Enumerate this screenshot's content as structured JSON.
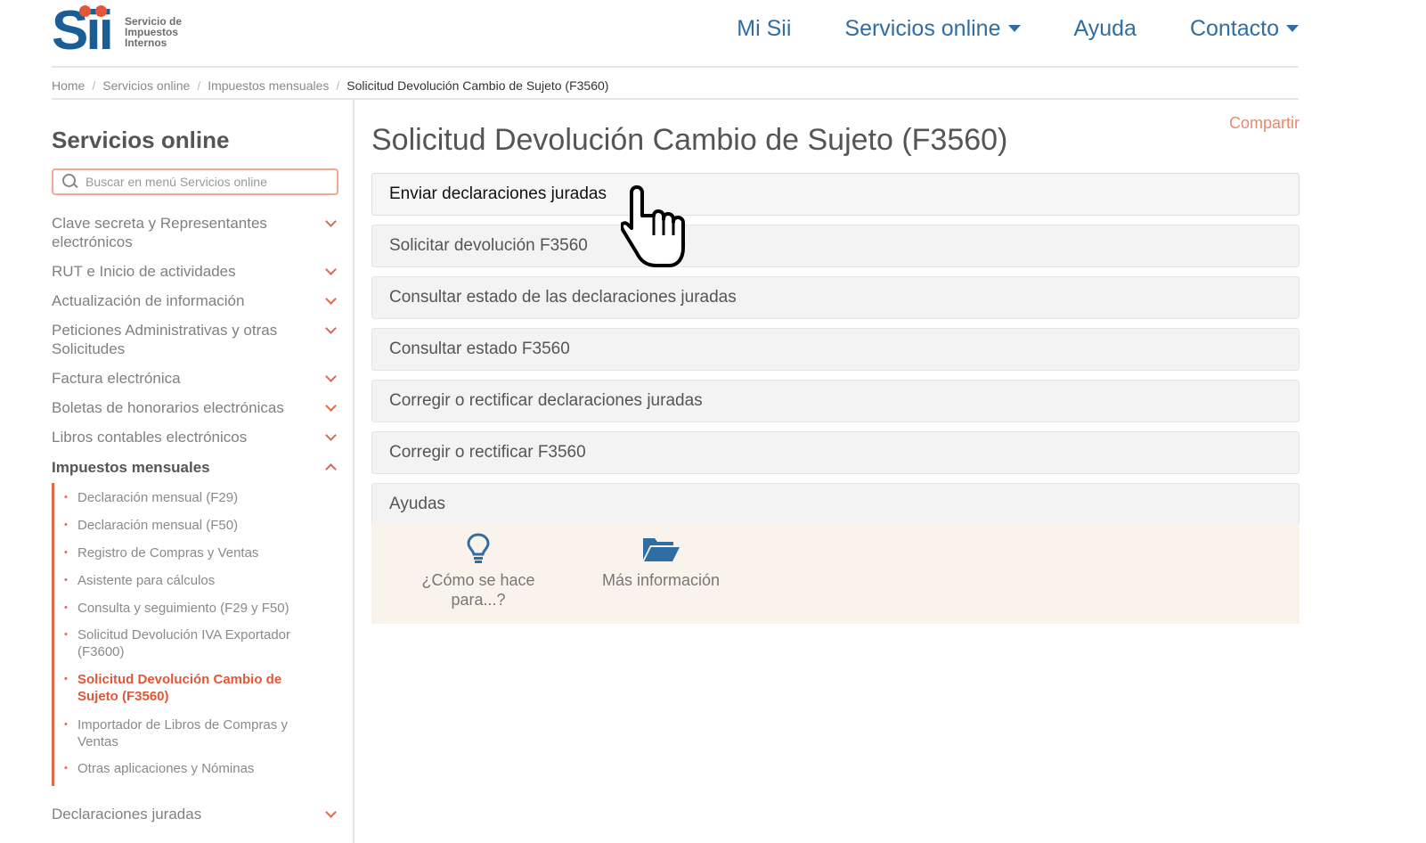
{
  "header": {
    "logo": {
      "mark": "Sii",
      "line1": "Servicio de",
      "line2": "Impuestos",
      "line3": "Internos"
    },
    "nav": [
      {
        "label": "Mi Sii",
        "has_caret": false
      },
      {
        "label": "Servicios online",
        "has_caret": true
      },
      {
        "label": "Ayuda",
        "has_caret": false
      },
      {
        "label": "Contacto",
        "has_caret": true
      }
    ]
  },
  "breadcrumb": {
    "items": [
      "Home",
      "Servicios online",
      "Impuestos mensuales"
    ],
    "current": "Solicitud Devolución Cambio de Sujeto (F3560)",
    "separator": "/"
  },
  "sidebar": {
    "title": "Servicios online",
    "search_placeholder": "Buscar en menú Servicios online",
    "items": [
      {
        "label": "Clave secreta y Representantes electrónicos",
        "expanded": false
      },
      {
        "label": "RUT e Inicio de actividades",
        "expanded": false
      },
      {
        "label": "Actualización de información",
        "expanded": false
      },
      {
        "label": "Peticiones Administrativas y otras Solicitudes",
        "expanded": false
      },
      {
        "label": "Factura electrónica",
        "expanded": false
      },
      {
        "label": "Boletas de honorarios electrónicas",
        "expanded": false
      },
      {
        "label": "Libros contables electrónicos",
        "expanded": false
      },
      {
        "label": "Impuestos mensuales",
        "expanded": true
      },
      {
        "label": "Declaraciones juradas",
        "expanded": false
      }
    ],
    "subitems": [
      {
        "label": "Declaración mensual (F29)",
        "active": false
      },
      {
        "label": "Declaración mensual (F50)",
        "active": false
      },
      {
        "label": "Registro de Compras y Ventas",
        "active": false
      },
      {
        "label": "Asistente para cálculos",
        "active": false
      },
      {
        "label": "Consulta y seguimiento (F29 y F50)",
        "active": false
      },
      {
        "label": "Solicitud Devolución IVA Exportador (F3600)",
        "active": false
      },
      {
        "label": "Solicitud Devolución Cambio de Sujeto (F3560)",
        "active": true
      },
      {
        "label": "Importador de Libros de Compras y Ventas",
        "active": false
      },
      {
        "label": "Otras aplicaciones y Nóminas",
        "active": false
      }
    ]
  },
  "main": {
    "share_label": "Compartir",
    "title": "Solicitud Devolución Cambio de Sujeto (F3560)",
    "options": [
      "Enviar declaraciones juradas",
      "Solicitar devolución F3560",
      "Consultar estado de las declaraciones juradas",
      "Consultar estado F3560",
      "Corregir o rectificar declaraciones juradas",
      "Corregir o rectificar F3560",
      "Ayudas"
    ],
    "help": {
      "how_to_label": "¿Cómo se hace para...?",
      "more_info_label": "Más información"
    }
  },
  "colors": {
    "brand_blue": "#1b5e96",
    "nav_blue": "#2f6ea5",
    "accent_red": "#e0674b",
    "help_bg": "#faf3ec"
  },
  "icons": [
    "search-icon",
    "chevron-down-icon",
    "chevron-up-icon",
    "lightbulb-icon",
    "folder-open-icon",
    "hand-pointer-cursor-icon"
  ]
}
